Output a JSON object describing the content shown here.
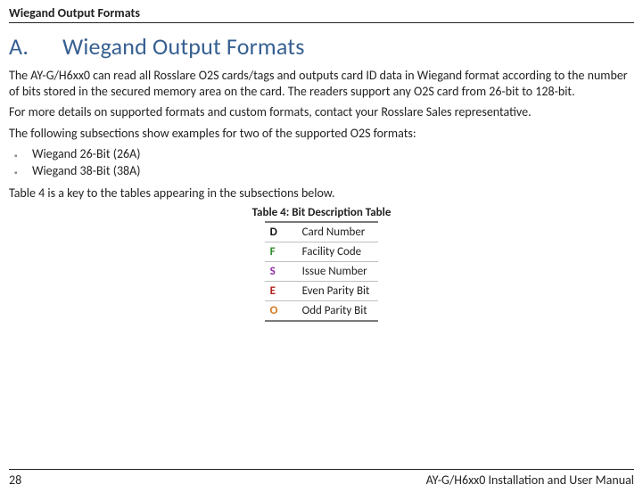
{
  "header": {
    "title": "Wiegand Output Formats"
  },
  "section": {
    "number": "A.",
    "title": "Wiegand Output Formats"
  },
  "paragraphs": {
    "p1": "The AY-G/H6xx0 can read all Rosslare O2S cards/tags and outputs card ID data in Wiegand format according to the number of bits stored in the secured memory area on the card. The readers support any O2S card from 26-bit to 128-bit.",
    "p2": "For more details on supported formats and custom formats, contact your Rosslare Sales representative.",
    "p3": "The following subsections show examples for two of the supported O2S formats:",
    "p4": "Table 4 is a key to the tables appearing in the subsections below."
  },
  "list": {
    "items": [
      "Wiegand 26-Bit (26A)",
      "Wiegand 38-Bit (38A)"
    ]
  },
  "table": {
    "caption": "Table 4: Bit Description Table",
    "rows": [
      {
        "key": "D",
        "cls": "c-black",
        "desc": "Card Number"
      },
      {
        "key": "F",
        "cls": "c-green",
        "desc": "Facility Code"
      },
      {
        "key": "S",
        "cls": "c-purple",
        "desc": "Issue Number"
      },
      {
        "key": "E",
        "cls": "c-red",
        "desc": "Even Parity Bit"
      },
      {
        "key": "O",
        "cls": "c-orange",
        "desc": "Odd Parity Bit"
      }
    ]
  },
  "footer": {
    "page": "28",
    "doc": "AY-G/H6xx0 Installation and User Manual"
  }
}
